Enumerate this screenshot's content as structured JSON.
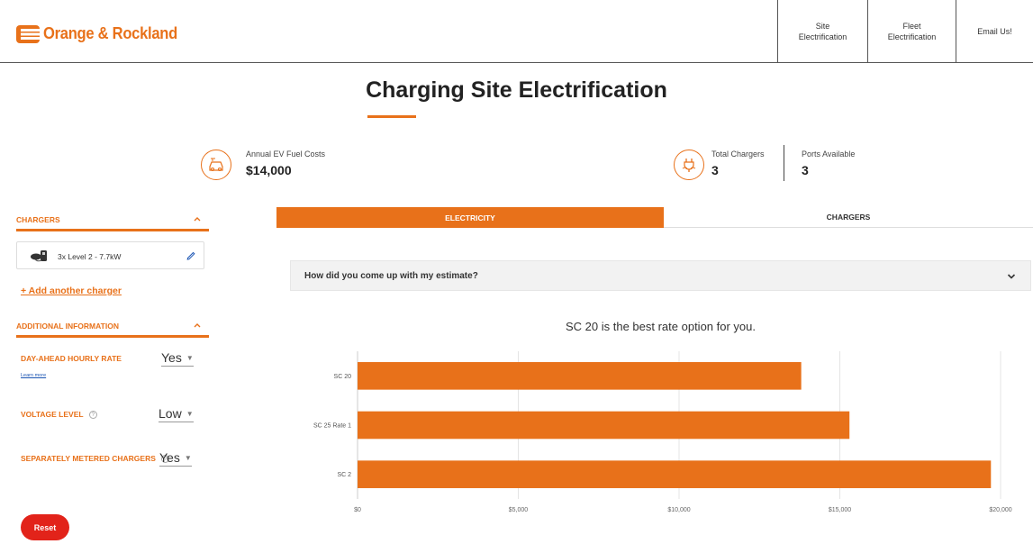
{
  "header": {
    "brand": "Orange & Rockland",
    "nav": [
      {
        "line1": "Site",
        "line2": "Electrification"
      },
      {
        "line1": "Fleet",
        "line2": "Electrification"
      },
      {
        "line1": "Email Us!",
        "line2": ""
      }
    ]
  },
  "page": {
    "title": "Charging Site Electrification"
  },
  "stats": {
    "fuel_label": "Annual EV Fuel Costs",
    "fuel_value": "$14,000",
    "chargers_label": "Total Chargers",
    "chargers_value": "3",
    "ports_label": "Ports Available",
    "ports_value": "3"
  },
  "sidebar": {
    "chargers_title": "CHARGERS",
    "charger_item": "3x Level 2 - 7.7kW",
    "add_charger": "+ Add another charger",
    "additional_title": "ADDITIONAL INFORMATION",
    "options": [
      {
        "label": "DAY-AHEAD HOURLY RATE",
        "value": "Yes"
      },
      {
        "label": "VOLTAGE LEVEL",
        "value": "Low"
      },
      {
        "label": "SEPARATELY METERED CHARGERS",
        "value": "Yes"
      }
    ],
    "learn_more": "Learn more",
    "reset": "Reset"
  },
  "tabs": {
    "electricity": "ELECTRICITY",
    "chargers": "CHARGERS"
  },
  "accordion": {
    "question": "How did you come up with my estimate?"
  },
  "result": {
    "best_text": "SC 20 is the best rate option for you."
  },
  "colors": {
    "accent": "#e8711a",
    "reset": "#e2231a",
    "link": "#1b55b3"
  },
  "chart_data": {
    "type": "bar",
    "orientation": "horizontal",
    "categories": [
      "SC 20",
      "SC 25 Rate 1",
      "SC 2"
    ],
    "values": [
      13800,
      15300,
      19700
    ],
    "xlim": [
      0,
      20000
    ],
    "xticks": [
      0,
      5000,
      10000,
      15000,
      20000
    ],
    "xtick_labels": [
      "$0",
      "$5,000",
      "$10,000",
      "$15,000",
      "$20,000"
    ],
    "grid": true,
    "color": "#e8711a"
  }
}
